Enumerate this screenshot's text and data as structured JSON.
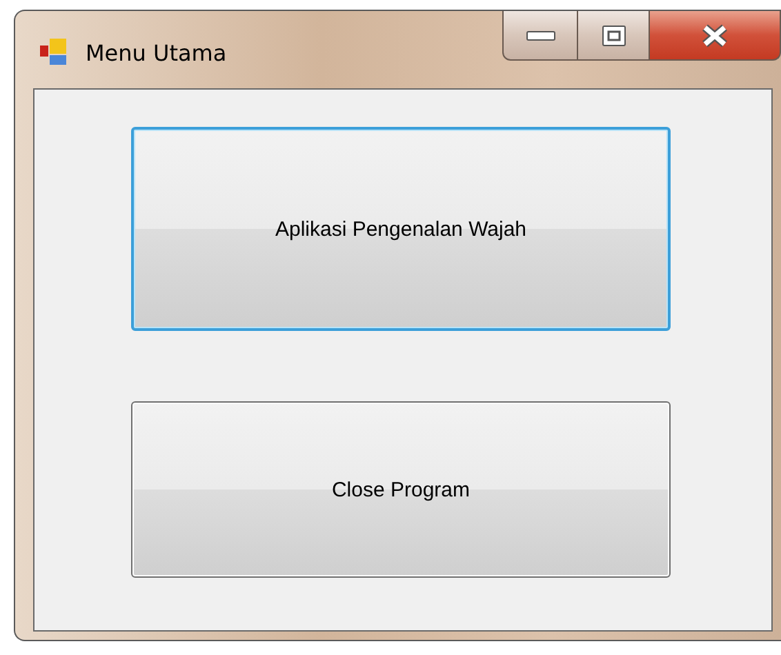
{
  "window": {
    "title": "Menu Utama",
    "caption_buttons": [
      {
        "kind": "minimize"
      },
      {
        "kind": "maximize"
      },
      {
        "kind": "close"
      }
    ]
  },
  "buttons": [
    {
      "label": "Aplikasi Pengenalan Wajah",
      "focused": true
    },
    {
      "label": "Close Program",
      "focused": false
    }
  ]
}
